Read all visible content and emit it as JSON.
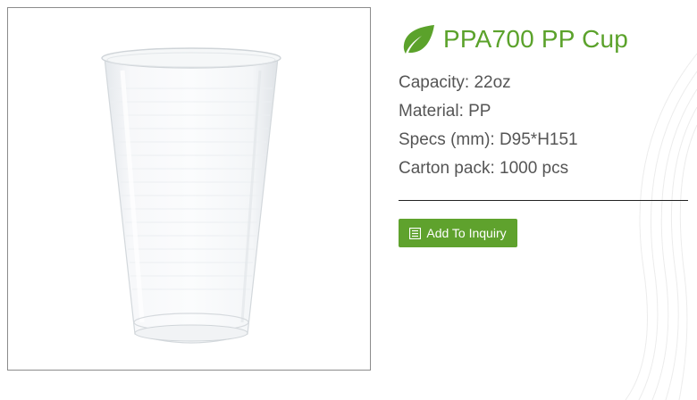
{
  "product": {
    "title": "PPA700 PP Cup",
    "specs": [
      {
        "label": "Capacity: 22oz"
      },
      {
        "label": "Material: PP"
      },
      {
        "label": "Specs (mm): D95*H151"
      },
      {
        "label": "Carton pack: 1000 pcs"
      }
    ],
    "inquiry_button_label": "Add To Inquiry"
  },
  "colors": {
    "brand_green": "#5ba22b",
    "button_green": "#5fa22d",
    "spec_text": "#555555"
  },
  "icons": {
    "leaf": "leaf-icon",
    "inquiry": "list-icon"
  }
}
